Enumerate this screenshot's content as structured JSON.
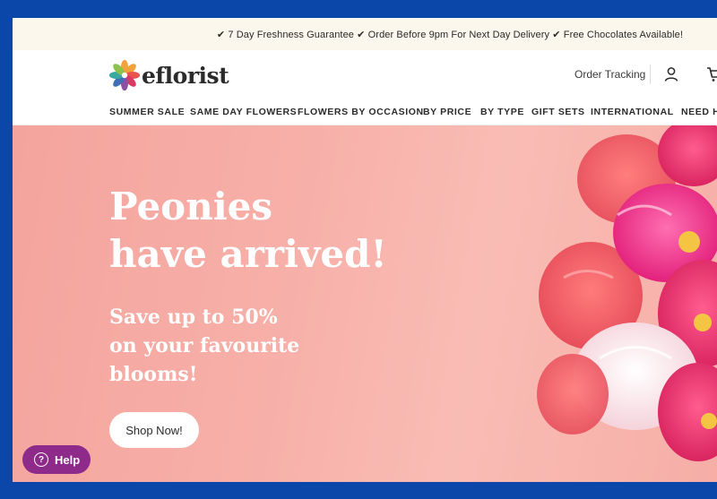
{
  "promo_bar": {
    "text": "✔ 7 Day Freshness Guarantee ✔ Order Before 9pm For Next Day Delivery ✔ Free Chocolates Available!"
  },
  "header": {
    "logo_text": "eflorist",
    "order_tracking": "Order Tracking",
    "icons": [
      "user-icon",
      "cart-icon"
    ]
  },
  "nav": {
    "items": [
      {
        "label": "SUMMER SALE"
      },
      {
        "label": "SAME DAY FLOWERS"
      },
      {
        "label": "FLOWERS BY OCCASION"
      },
      {
        "label": "BY PRICE"
      },
      {
        "label": "BY TYPE"
      },
      {
        "label": "GIFT SETS"
      },
      {
        "label": "INTERNATIONAL"
      },
      {
        "label": "NEED H"
      }
    ]
  },
  "hero": {
    "title_line1": "Peonies",
    "title_line2": "have arrived!",
    "sub_line1": "Save up to 50%",
    "sub_line2": "on your favourite",
    "sub_line3": "blooms!",
    "cta_label": "Shop Now!"
  },
  "help": {
    "label": "Help",
    "icon": "question-icon"
  },
  "colors": {
    "page_border": "#0a47a8",
    "promo_bg": "#fbf7ec",
    "hero_bg": "#f7b0a9",
    "help_bg": "#8e2a8a"
  }
}
